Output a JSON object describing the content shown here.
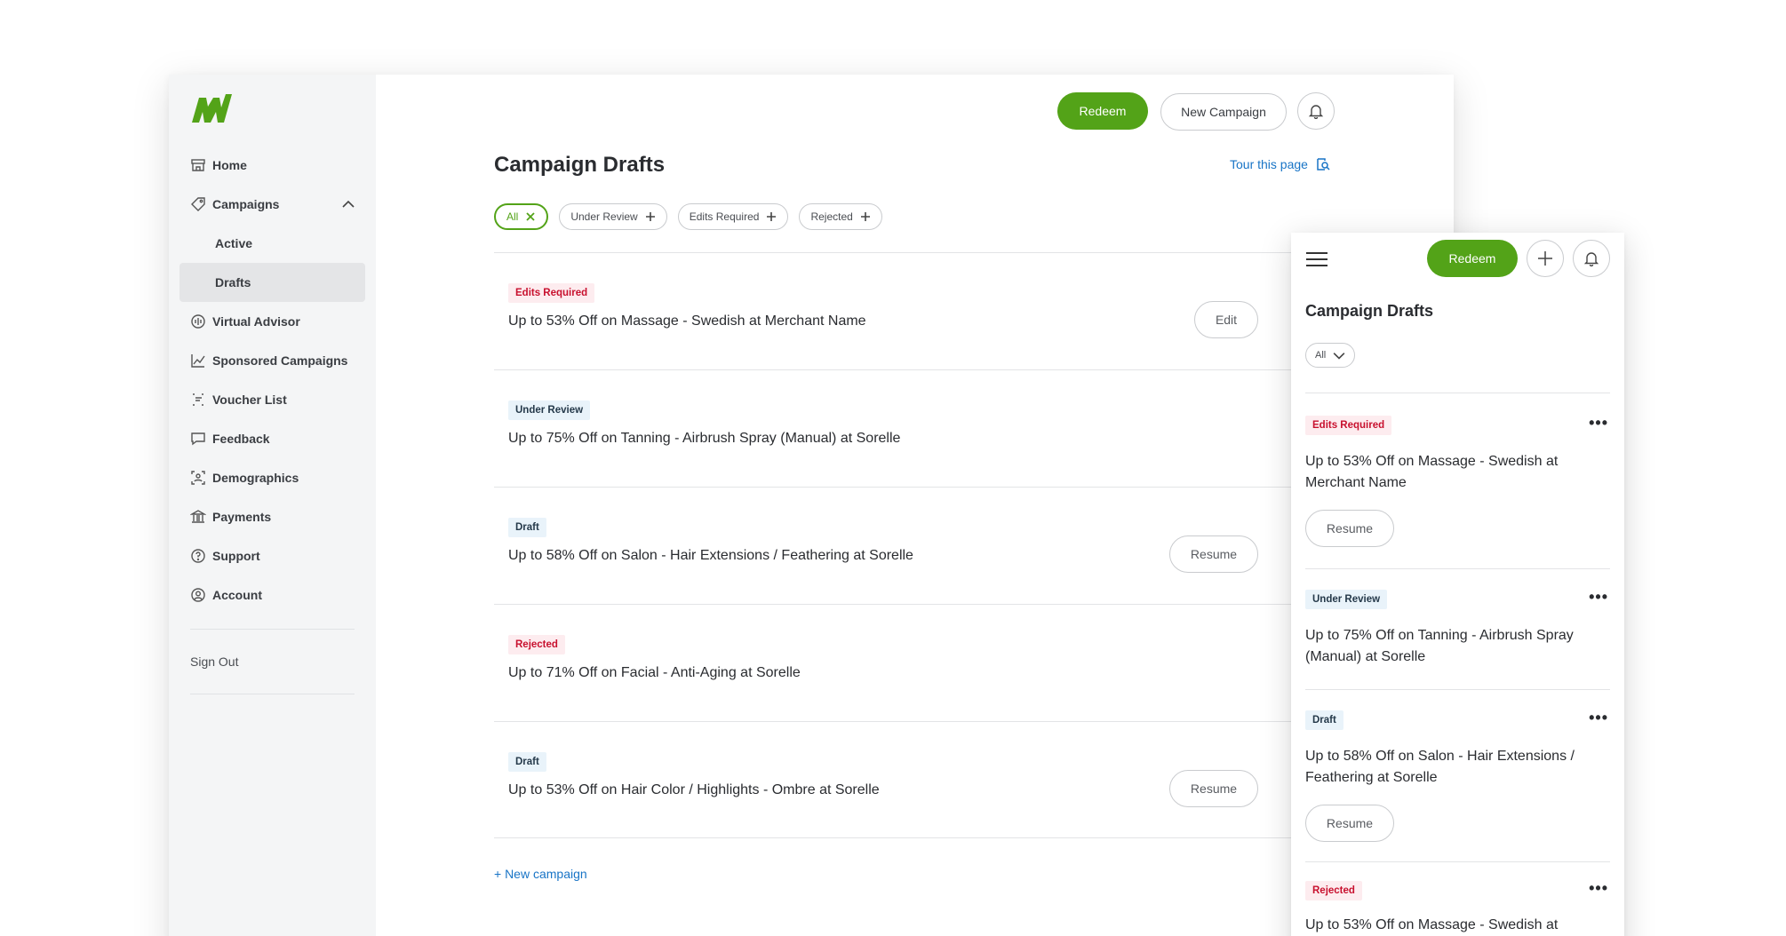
{
  "brand": {
    "accent": "#53a318",
    "link": "#1874c6",
    "danger": "#c8102e"
  },
  "sidebar": {
    "items": [
      {
        "label": "Home",
        "icon": "store-icon"
      },
      {
        "label": "Campaigns",
        "icon": "tag-icon"
      },
      {
        "label": "Active"
      },
      {
        "label": "Drafts"
      },
      {
        "label": "Virtual Advisor",
        "icon": "advisor-icon"
      },
      {
        "label": "Sponsored Campaigns",
        "icon": "chart-icon"
      },
      {
        "label": "Voucher List",
        "icon": "list-icon"
      },
      {
        "label": "Feedback",
        "icon": "comment-icon"
      },
      {
        "label": "Demographics",
        "icon": "person-scan-icon"
      },
      {
        "label": "Payments",
        "icon": "bank-icon"
      },
      {
        "label": "Support",
        "icon": "help-icon"
      },
      {
        "label": "Account",
        "icon": "user-circle-icon"
      }
    ],
    "signout": "Sign Out"
  },
  "header": {
    "redeem": "Redeem",
    "new_campaign": "New Campaign"
  },
  "main": {
    "title": "Campaign Drafts",
    "tour": "Tour this page",
    "filters": [
      "All",
      "Under Review",
      "Edits Required",
      "Rejected"
    ],
    "rows": [
      {
        "status": "Edits Required",
        "title": "Up to 53% Off on Massage - Swedish at Merchant Name",
        "action": "Edit"
      },
      {
        "status": "Under Review",
        "title": "Up to 75% Off on Tanning - Airbrush Spray (Manual) at Sorelle",
        "action": ""
      },
      {
        "status": "Draft",
        "title": "Up to 58% Off on Salon - Hair Extensions / Feathering at Sorelle",
        "action": "Resume"
      },
      {
        "status": "Rejected",
        "title": "Up to 71% Off on Facial - Anti-Aging at Sorelle",
        "action": ""
      },
      {
        "status": "Draft",
        "title": "Up to 53% Off on Hair Color / Highlights - Ombre at Sorelle",
        "action": "Resume"
      }
    ],
    "new_campaign_link": "+ New campaign"
  },
  "mobile": {
    "redeem": "Redeem",
    "title": "Campaign Drafts",
    "filter": "All",
    "rows": [
      {
        "status": "Edits Required",
        "title": "Up to 53% Off on Massage - Swedish at Merchant Name",
        "action": "Resume"
      },
      {
        "status": "Under Review",
        "title": "Up to 75% Off on Tanning - Airbrush Spray (Manual) at Sorelle",
        "action": ""
      },
      {
        "status": "Draft",
        "title": "Up to 58% Off on Salon - Hair Extensions / Feathering at Sorelle",
        "action": "Resume"
      },
      {
        "status": "Rejected",
        "title": "Up to 53% Off on Massage - Swedish at",
        "action": ""
      }
    ],
    "more": "•••"
  }
}
